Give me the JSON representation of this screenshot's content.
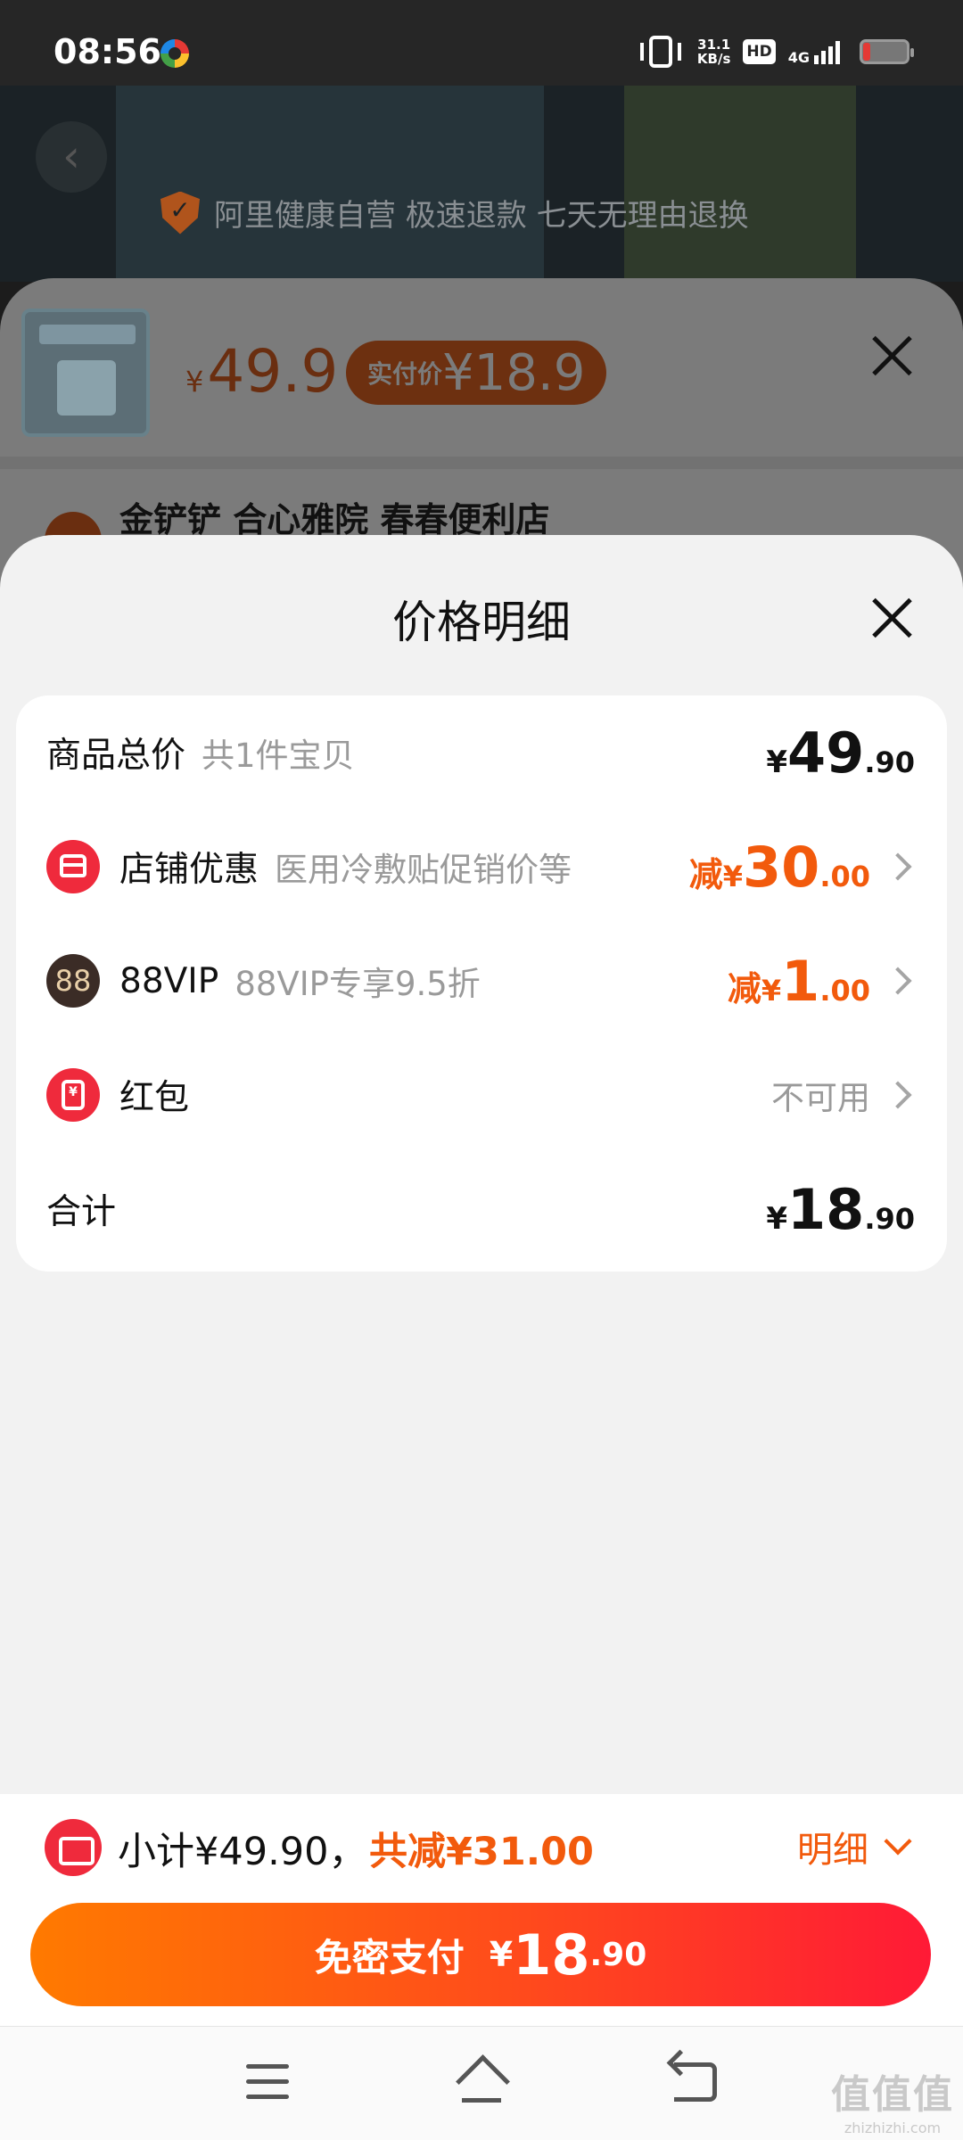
{
  "status_bar": {
    "time": "08:56",
    "net_speed": "31.1",
    "net_unit": "KB/s",
    "hd": "HD",
    "network": "4G"
  },
  "background_page": {
    "badge_text": "阿里健康自营 极速退款 七天无理由退换"
  },
  "sku_sheet": {
    "price_currency": "¥",
    "price": "49.9",
    "actual_label": "实付价",
    "actual_price": "¥18.9",
    "shop_line": "金铲铲 合心雅院  春春便利店"
  },
  "detail_sheet": {
    "title": "价格明细",
    "rows": [
      {
        "label": "商品总价",
        "sub": "共1件宝贝",
        "currency": "¥",
        "int": "49",
        "dec": ".90"
      },
      {
        "label": "店铺优惠",
        "sub": "医用冷敷贴促销价等",
        "prefix": "减",
        "currency": "¥",
        "int": "30",
        "dec": ".00",
        "icon": "shop-icon"
      },
      {
        "label": "88VIP",
        "sub": "88VIP专享9.5折",
        "prefix": "减",
        "currency": "¥",
        "int": "1",
        "dec": ".00",
        "icon_text": "88"
      },
      {
        "label": "红包",
        "value": "不可用",
        "icon": "red-packet-icon"
      },
      {
        "label": "合计",
        "currency": "¥",
        "int": "18",
        "dec": ".90"
      }
    ]
  },
  "summary": {
    "subtotal": "小计¥49.90，",
    "saved": "共减¥31.00",
    "detail_label": "明细"
  },
  "pay_button": {
    "label": "免密支付",
    "currency": "¥",
    "int": "18",
    "dec": ".90"
  },
  "watermark": {
    "big": "值值值",
    "small": "zhizhizhi.com"
  },
  "colors": {
    "accent": "#f25a0c",
    "brand_red": "#ef2a3c",
    "background": "#f2f2f2"
  }
}
